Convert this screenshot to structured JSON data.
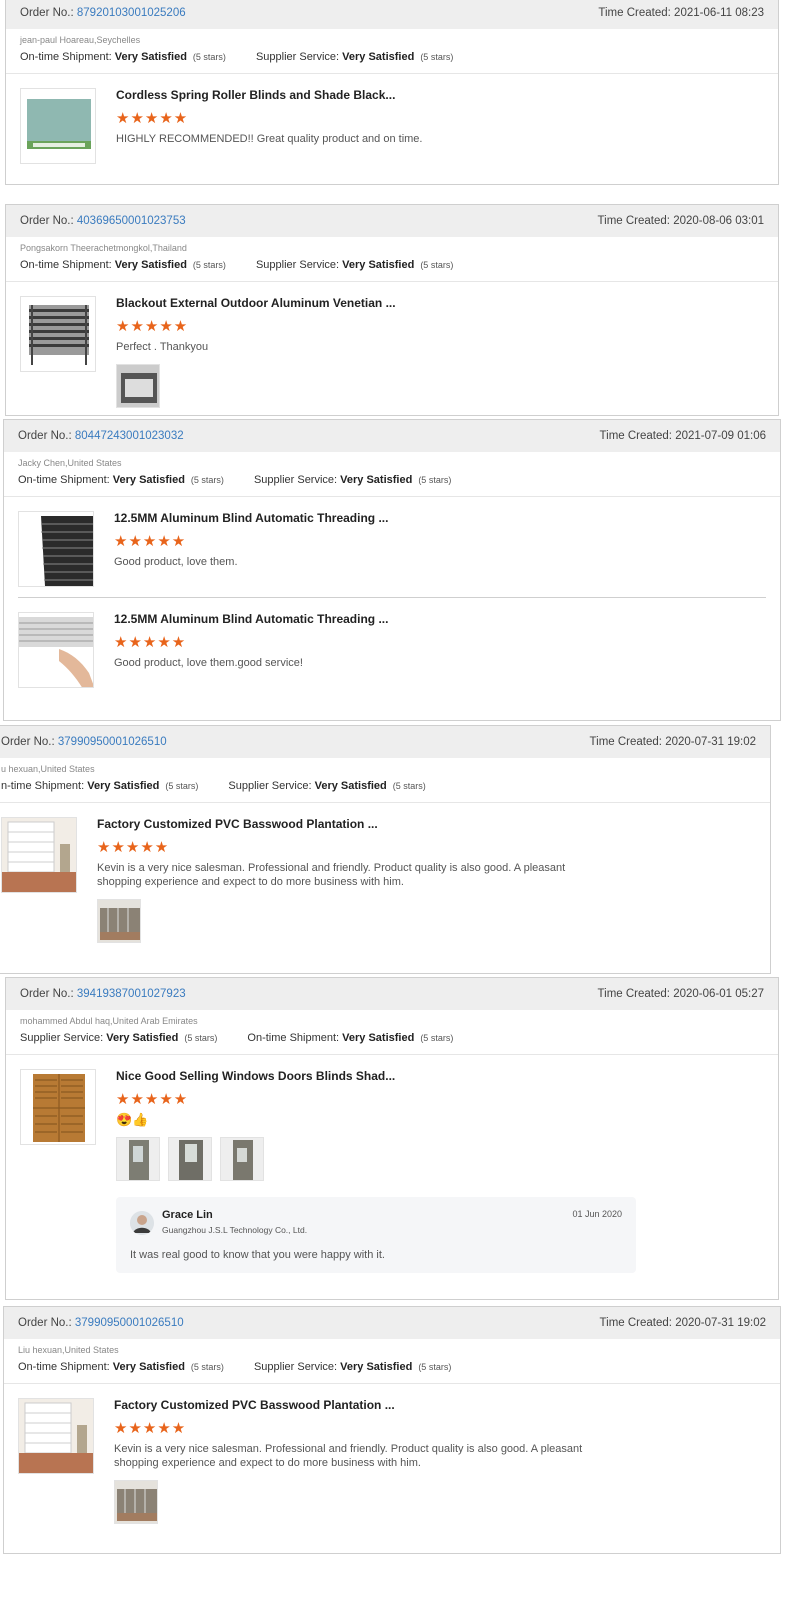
{
  "labels": {
    "order_no": "Order No.:",
    "time_created": "Time Created:",
    "ontime": "On-time Shipment:",
    "ontime_cut": "n-time Shipment:",
    "supplier": "Supplier Service:",
    "very_satisfied": "Very Satisfied",
    "five_stars": "(5 stars)",
    "stars": "★★★★★"
  },
  "cards": [
    {
      "order_no": "87920103001025206",
      "time": "2021-06-11 08:23",
      "buyer": "jean-paul Hoareau,Seychelles",
      "product": {
        "title": "Cordless Spring Roller Blinds and Shade Black...",
        "review": "HIGHLY RECOMMENDED!! Great quality product and on time.",
        "thumb": "roller-blind-thumbnail"
      }
    },
    {
      "order_no": "40369650001023753",
      "time": "2020-08-06 03:01",
      "buyer": "Pongsakorn Theerachetmongkol,Thailand",
      "product": {
        "title": "Blackout External Outdoor Aluminum Venetian ...",
        "review": "Perfect . Thankyou",
        "thumb": "external-venetian-blind-thumbnail"
      }
    },
    {
      "order_no": "80447243001023032",
      "time": "2021-07-09 01:06",
      "buyer": "Jacky Chen,United States",
      "products": [
        {
          "title": "12.5MM Aluminum Blind Automatic Threading ...",
          "review": "Good product, love them."
        },
        {
          "title": "12.5MM Aluminum Blind Automatic Threading ...",
          "review": "Good product, love them.good service!"
        }
      ]
    },
    {
      "order_no": "37990950001026510",
      "time": "2020-07-31 19:02",
      "buyer": "u hexuan,United States",
      "product": {
        "title": "Factory Customized PVC Basswood Plantation ...",
        "review": "Kevin is a very nice salesman. Professional and friendly. Product quality is also good. A pleasant shopping experience and expect to do more business with him."
      }
    },
    {
      "order_no": "39419387001027923",
      "time": "2020-06-01 05:27",
      "buyer": "mohammed Abdul haq,United Arab Emirates",
      "product": {
        "title": "Nice Good Selling Windows Doors Blinds Shad...",
        "review": "😍👍"
      },
      "reply": {
        "name": "Grace Lin",
        "company": "Guangzhou J.S.L Technology Co., Ltd.",
        "date": "01 Jun 2020",
        "text": "It was real good to know that you were happy with it."
      }
    },
    {
      "order_no": "37990950001026510",
      "time": "2020-07-31 19:02",
      "buyer": "Liu hexuan,United States",
      "product": {
        "title": "Factory Customized PVC Basswood Plantation ...",
        "review": "Kevin is a very nice salesman. Professional and friendly. Product quality is also good. A pleasant shopping experience and expect to do more business with him."
      }
    }
  ]
}
